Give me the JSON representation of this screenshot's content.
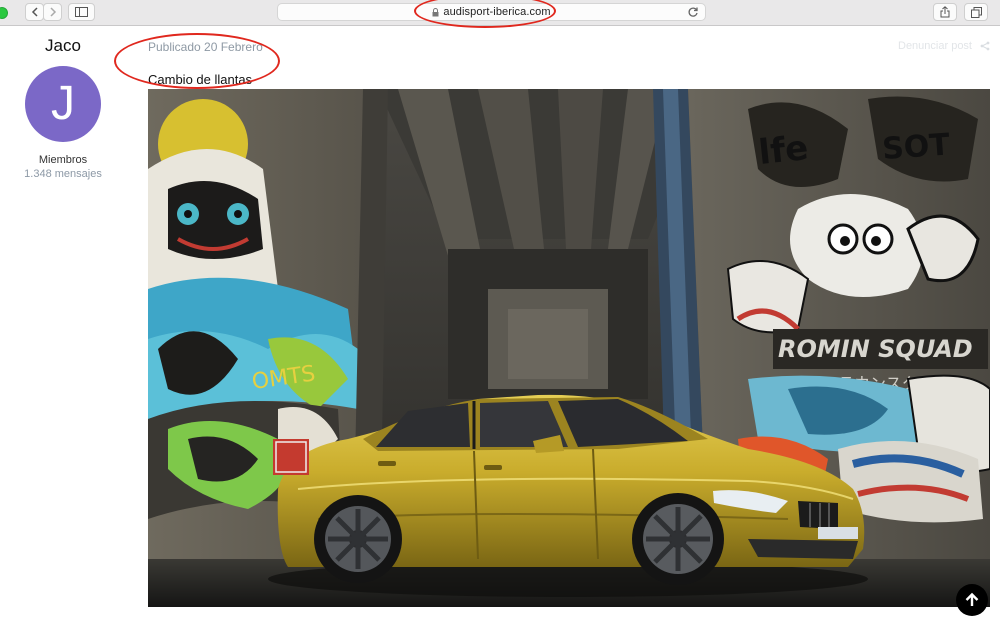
{
  "browser": {
    "url": "audisport-iberica.com",
    "icons": [
      "back-icon",
      "forward-icon",
      "sidebar-icon",
      "lock-icon",
      "reload-icon",
      "share-icon",
      "tabs-icon"
    ]
  },
  "author": {
    "name": "Jaco",
    "avatar_letter": "J",
    "avatar_color": "#7b68c7",
    "role": "Miembros",
    "posts": "1.348 mensajes"
  },
  "post": {
    "date": "Publicado 20 Febrero",
    "title": "Cambio de llantas",
    "faded_link": "Denunciar post",
    "photo_subject": "gold-car-under-graffiti-bridge"
  },
  "colors": {
    "annotation_red": "#e0281e",
    "muted_text": "#8e99a4",
    "car_gold": "#c9ac2c"
  }
}
